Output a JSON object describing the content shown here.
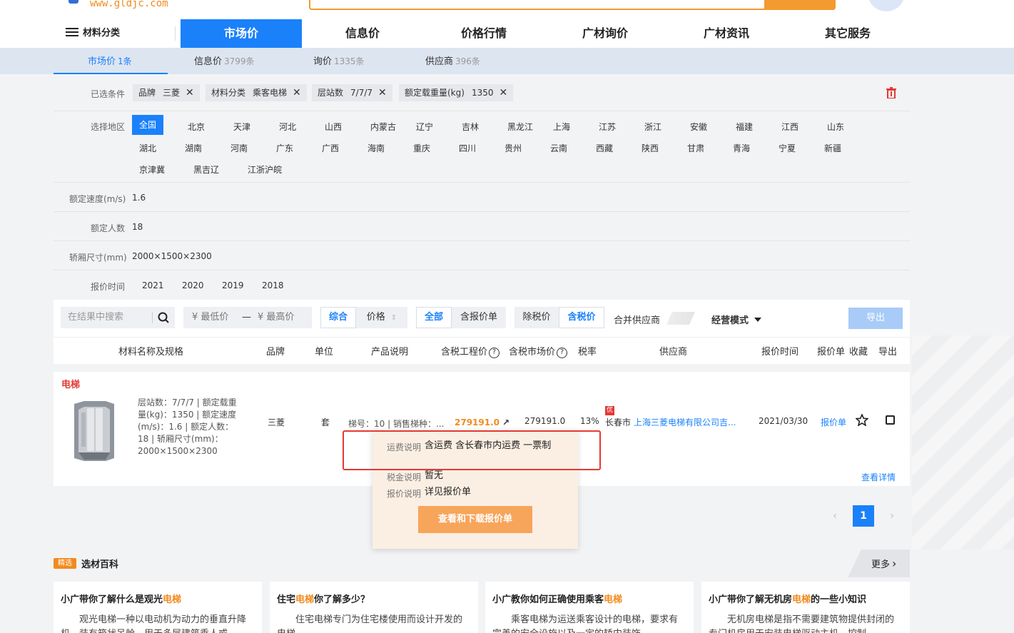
{
  "header": {
    "logo_text": "www.gldjc.com",
    "categories_label": "材料分类",
    "nav": [
      "市场价",
      "信息价",
      "价格行情",
      "广材询价",
      "广材资讯",
      "其它服务"
    ],
    "nav_active_index": 0
  },
  "tabs": [
    {
      "label": "市场价",
      "count": "1条"
    },
    {
      "label": "信息价",
      "count": "3799条"
    },
    {
      "label": "询价",
      "count": "1335条"
    },
    {
      "label": "供应商",
      "count": "396条"
    }
  ],
  "filters": {
    "selected_label": "已选条件",
    "chips": [
      {
        "key": "品牌",
        "value": "三菱"
      },
      {
        "key": "材料分类",
        "value": "乘客电梯"
      },
      {
        "key": "层站数",
        "value": "7/7/7"
      },
      {
        "key": "额定载重量(kg)",
        "value": "1350"
      }
    ],
    "region_label": "选择地区",
    "regions": [
      "全国",
      "北京",
      "天津",
      "河北",
      "山西",
      "内蒙古",
      "辽宁",
      "吉林",
      "黑龙江",
      "上海",
      "江苏",
      "浙江",
      "安徽",
      "福建",
      "江西",
      "山东",
      "湖北",
      "湖南",
      "河南",
      "广东",
      "广西",
      "海南",
      "重庆",
      "四川",
      "贵州",
      "云南",
      "西藏",
      "陕西",
      "甘肃",
      "青海",
      "宁夏",
      "新疆",
      "京津冀",
      "黑吉辽",
      "江浙沪皖"
    ],
    "region_active": "全国",
    "speed_label": "额定速度(m/s)",
    "speed_value": "1.6",
    "people_label": "额定人数",
    "people_value": "18",
    "cabin_label": "轿厢尺寸(mm)",
    "cabin_value": "2000×1500×2300",
    "time_label": "报价时间",
    "years": [
      "2021",
      "2020",
      "2019",
      "2018"
    ]
  },
  "toolbar": {
    "search_placeholder": "在结果中搜索",
    "min_price": "¥ 最低价",
    "dash": "—",
    "max_price": "¥ 最高价",
    "sort_all": "综合",
    "sort_price": "价格",
    "scope_all": "全部",
    "scope_quote": "含报价单",
    "tax_ex": "除税价",
    "tax_in": "含税价",
    "merge_supplier": "合并供应商",
    "mode": "经营模式",
    "export": "导出"
  },
  "columns": [
    "材料名称及规格",
    "品牌",
    "单位",
    "产品说明",
    "含税工程价",
    "含税市场价",
    "税率",
    "供应商",
    "报价时间",
    "报价单",
    "收藏",
    "导出"
  ],
  "result": {
    "category": "电梯",
    "spec_lines": [
      "层站数：7/7/7 | 额定载重",
      "量(kg)：1350 | 额定速度",
      "(m/s)：1.6 | 额定人数：",
      "18 | 轿厢尺寸(mm)：",
      "2000×1500×2300"
    ],
    "brand": "三菱",
    "unit": "套",
    "desc": "梯号：10 | 销售梯种：...",
    "eng_price": "279191.0",
    "market_price": "279191.0",
    "tax_rate": "13%",
    "badge": "优",
    "city": "长春市",
    "supplier": "上海三菱电梯有限公司吉...",
    "date": "2021/03/30",
    "quote_link": "报价单",
    "detail_link": "查看详情"
  },
  "popup": {
    "freight_label": "运费说明",
    "freight_value": "含运费 含长春市内运费 一票制",
    "tax_label": "税金说明",
    "tax_value": "暂无",
    "quote_label": "报价说明",
    "quote_value": "详见报价单",
    "button": "查看和下载报价单"
  },
  "pagination": {
    "current": "1"
  },
  "encyclopedia": {
    "badge": "精选",
    "title": "选材百科",
    "more": "更多",
    "articles": [
      {
        "pre": "小广带你了解什么是观光",
        "hl": "电梯",
        "post": "",
        "desc": "观光电梯一种以电动机为动力的垂直升降机，装有箱状吊舱，用于多层建筑乘人或"
      },
      {
        "pre": "住宅",
        "hl": "电梯",
        "post": "你了解多少？",
        "desc": "住宅电梯专门为住宅楼使用而设计开发的电梯"
      },
      {
        "pre": "小广教你如何正确使用乘客",
        "hl": "电梯",
        "post": "",
        "desc": "乘客电梯为运送乘客设计的电梯，要求有完善的安全设施以及一定的轿内装饰"
      },
      {
        "pre": "小广带你了解无机房",
        "hl": "电梯",
        "post": "的一些小知识",
        "desc": "无机房电梯是指不需要建筑物提供封闭的专门机房用于安装电梯驱动主机、控制"
      }
    ]
  },
  "colors": {
    "primary": "#1a81fb",
    "orange": "#f28a1e",
    "red": "#e53935"
  }
}
